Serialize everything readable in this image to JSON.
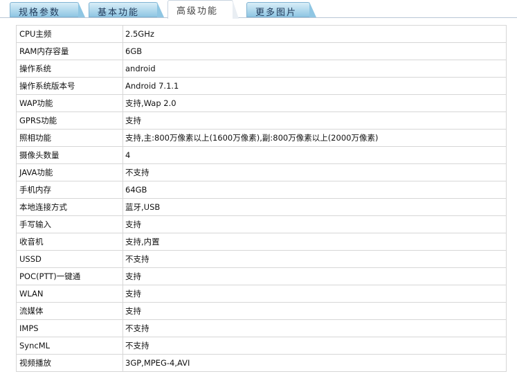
{
  "tabs": [
    {
      "label": "规格参数"
    },
    {
      "label": "基本功能"
    },
    {
      "label": "高级功能"
    },
    {
      "label": "更多图片"
    }
  ],
  "active_tab": "高级功能",
  "specs": [
    {
      "label": "CPU主频",
      "value": "2.5GHz"
    },
    {
      "label": "RAM内存容量",
      "value": "6GB"
    },
    {
      "label": "操作系统",
      "value": "android"
    },
    {
      "label": "操作系统版本号",
      "value": "Android 7.1.1"
    },
    {
      "label": "WAP功能",
      "value": "支持,Wap 2.0"
    },
    {
      "label": "GPRS功能",
      "value": "支持"
    },
    {
      "label": "照相功能",
      "value": "支持,主:800万像素以上(1600万像素),副:800万像素以上(2000万像素)"
    },
    {
      "label": "摄像头数量",
      "value": "4"
    },
    {
      "label": "JAVA功能",
      "value": "不支持"
    },
    {
      "label": "手机内存",
      "value": "64GB"
    },
    {
      "label": "本地连接方式",
      "value": "蓝牙,USB"
    },
    {
      "label": "手写输入",
      "value": "支持"
    },
    {
      "label": "收音机",
      "value": "支持,内置"
    },
    {
      "label": "USSD",
      "value": "不支持"
    },
    {
      "label": "POC(PTT)一键通",
      "value": "支持"
    },
    {
      "label": "WLAN",
      "value": "支持"
    },
    {
      "label": "流媒体",
      "value": "支持"
    },
    {
      "label": "IMPS",
      "value": "不支持"
    },
    {
      "label": "SyncML",
      "value": "不支持"
    },
    {
      "label": "视频播放",
      "value": "3GP,MPEG-4,AVI"
    }
  ]
}
